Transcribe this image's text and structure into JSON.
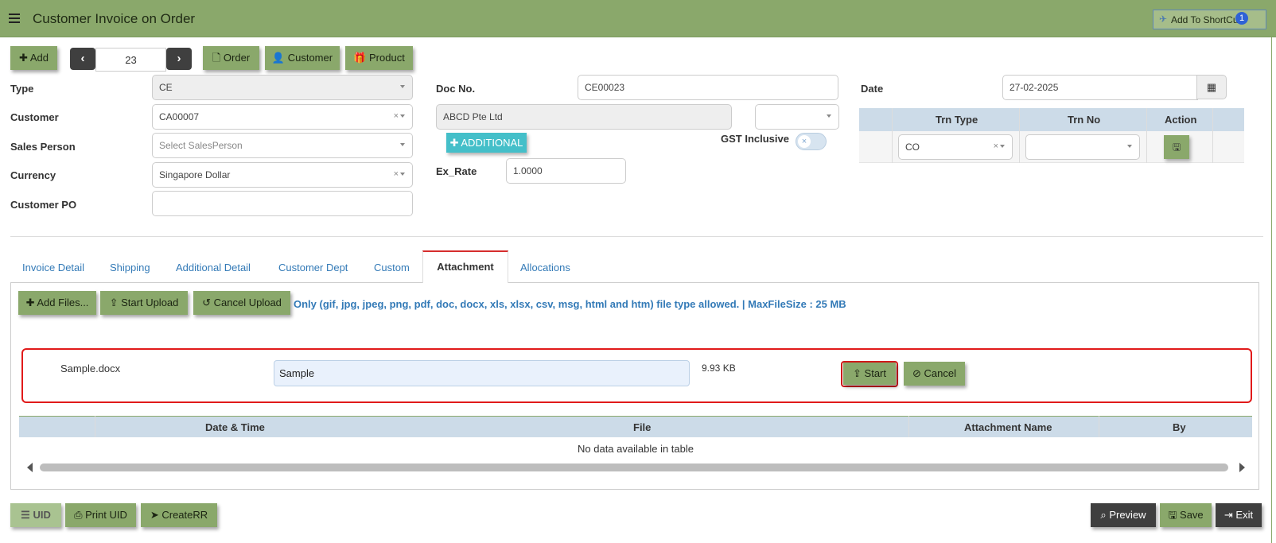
{
  "app": {
    "title": "Customer Invoice on Order",
    "shortcut_label": "Add To ShortCut",
    "shortcut_badge": "1"
  },
  "toolbar": {
    "add_label": "Add",
    "record_number": "23",
    "order_label": "Order",
    "customer_label": "Customer",
    "product_label": "Product"
  },
  "form": {
    "type_label": "Type",
    "type_value": "CE",
    "customer_label": "Customer",
    "customer_value": "CA00007",
    "salesperson_label": "Sales Person",
    "salesperson_placeholder": "Select SalesPerson",
    "currency_label": "Currency",
    "currency_value": "Singapore Dollar",
    "customer_po_label": "Customer PO",
    "customer_po_value": "",
    "docno_label": "Doc No.",
    "docno_value": "CE00023",
    "customer_name": "ABCD Pte Ltd",
    "additional_label": "ADDITIONAL",
    "gst_inclusive_label": "GST Inclusive",
    "gst_inclusive_on": false,
    "ex_rate_label": "Ex_Rate",
    "ex_rate_value": "1.0000",
    "date_label": "Date",
    "date_value": "27-02-2025"
  },
  "trn_table": {
    "headers": [
      "Trn Type",
      "Trn No",
      "Action"
    ],
    "row": {
      "trn_type": "CO",
      "trn_no": ""
    }
  },
  "tabs": [
    {
      "label": "Invoice Detail",
      "active": false
    },
    {
      "label": "Shipping",
      "active": false
    },
    {
      "label": "Additional Detail",
      "active": false
    },
    {
      "label": "Customer Dept",
      "active": false
    },
    {
      "label": "Custom",
      "active": false
    },
    {
      "label": "Attachment",
      "active": true
    },
    {
      "label": "Allocations",
      "active": false
    }
  ],
  "attachment": {
    "add_files_label": "Add Files...",
    "start_upload_label": "Start Upload",
    "cancel_upload_label": "Cancel Upload",
    "allowed_text": "Only (gif, jpg, jpeg, png, pdf, doc, docx, xls, xlsx, csv, msg, html and htm) file type allowed. | MaxFileSize : 25 MB",
    "pending_file": {
      "filename": "Sample.docx",
      "name_value": "Sample",
      "size": "9.93 KB",
      "start_label": "Start",
      "cancel_label": "Cancel"
    },
    "table_headers": [
      "Date & Time",
      "File",
      "Attachment Name",
      "By"
    ],
    "empty_message": "No data available in table"
  },
  "footer": {
    "uid_label": "UID",
    "print_uid_label": "Print UID",
    "create_rr_label": "CreateRR",
    "preview_label": "Preview",
    "save_label": "Save",
    "exit_label": "Exit"
  },
  "colors": {
    "brand_green": "#8aa86b",
    "link_blue": "#337ab7",
    "header_blue": "#ccdbe8",
    "highlight_red": "#e11a1a",
    "additional_teal": "#44bfc9"
  }
}
